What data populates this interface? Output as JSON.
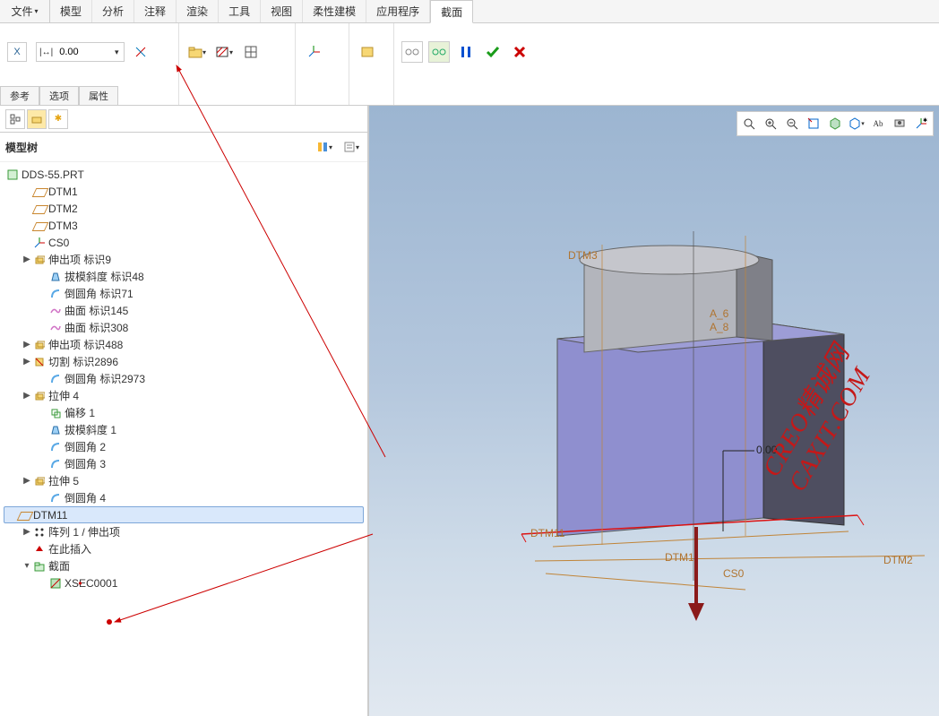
{
  "menubar": {
    "file_label": "文件",
    "tabs": [
      "模型",
      "分析",
      "注释",
      "渲染",
      "工具",
      "视图",
      "柔性建模",
      "应用程序",
      "截面"
    ],
    "active_tab_index": 8
  },
  "ribbon": {
    "x_label": "X",
    "value": "0.00",
    "tabs_below": [
      "参考",
      "选项",
      "属性"
    ]
  },
  "sidebar": {
    "title": "模型树",
    "root": "DDS-55.PRT",
    "items": [
      {
        "label": "DTM1",
        "icon": "datum",
        "indent": 1
      },
      {
        "label": "DTM2",
        "icon": "datum",
        "indent": 1
      },
      {
        "label": "DTM3",
        "icon": "datum",
        "indent": 1
      },
      {
        "label": "CS0",
        "icon": "csys",
        "indent": 1
      },
      {
        "label": "伸出项 标识9",
        "icon": "extrude",
        "indent": 1,
        "tw": "▶"
      },
      {
        "label": "拔模斜度 标识48",
        "icon": "draft",
        "indent": 2
      },
      {
        "label": "倒圆角 标识71",
        "icon": "round",
        "indent": 2
      },
      {
        "label": "曲面 标识145",
        "icon": "surface",
        "indent": 2
      },
      {
        "label": "曲面 标识308",
        "icon": "surface",
        "indent": 2
      },
      {
        "label": "伸出项 标识488",
        "icon": "extrude",
        "indent": 1,
        "tw": "▶"
      },
      {
        "label": "切割 标识2896",
        "icon": "cut",
        "indent": 1,
        "tw": "▶"
      },
      {
        "label": "倒圆角 标识2973",
        "icon": "round",
        "indent": 2
      },
      {
        "label": "拉伸 4",
        "icon": "extrude",
        "indent": 1,
        "tw": "▶"
      },
      {
        "label": "偏移 1",
        "icon": "offset",
        "indent": 2
      },
      {
        "label": "拔模斜度 1",
        "icon": "draft",
        "indent": 2
      },
      {
        "label": "倒圆角 2",
        "icon": "round",
        "indent": 2
      },
      {
        "label": "倒圆角 3",
        "icon": "round",
        "indent": 2
      },
      {
        "label": "拉伸 5",
        "icon": "extrude",
        "indent": 1,
        "tw": "▶"
      },
      {
        "label": "倒圆角 4",
        "icon": "round",
        "indent": 2
      },
      {
        "label": "DTM11",
        "icon": "datum",
        "indent": 1,
        "selected": true
      },
      {
        "label": "阵列 1 / 伸出项",
        "icon": "pattern",
        "indent": 1,
        "tw": "▶"
      },
      {
        "label": "在此插入",
        "icon": "insert",
        "indent": 1
      },
      {
        "label": "截面",
        "icon": "folder",
        "indent": 1,
        "tw": "▾"
      },
      {
        "label": "XSEC0001",
        "icon": "xsec",
        "indent": 2,
        "marked": true
      }
    ]
  },
  "viewport": {
    "dim_label": "0.00",
    "planes": {
      "dtm11": "DTM11",
      "dtm1": "DTM1",
      "dtm2": "DTM2",
      "cs0": "CS0",
      "a6": "A_6",
      "a8": "A_8",
      "dtm3": "DTM3"
    }
  },
  "watermark": "CREO精诚网CAXIT.COM"
}
